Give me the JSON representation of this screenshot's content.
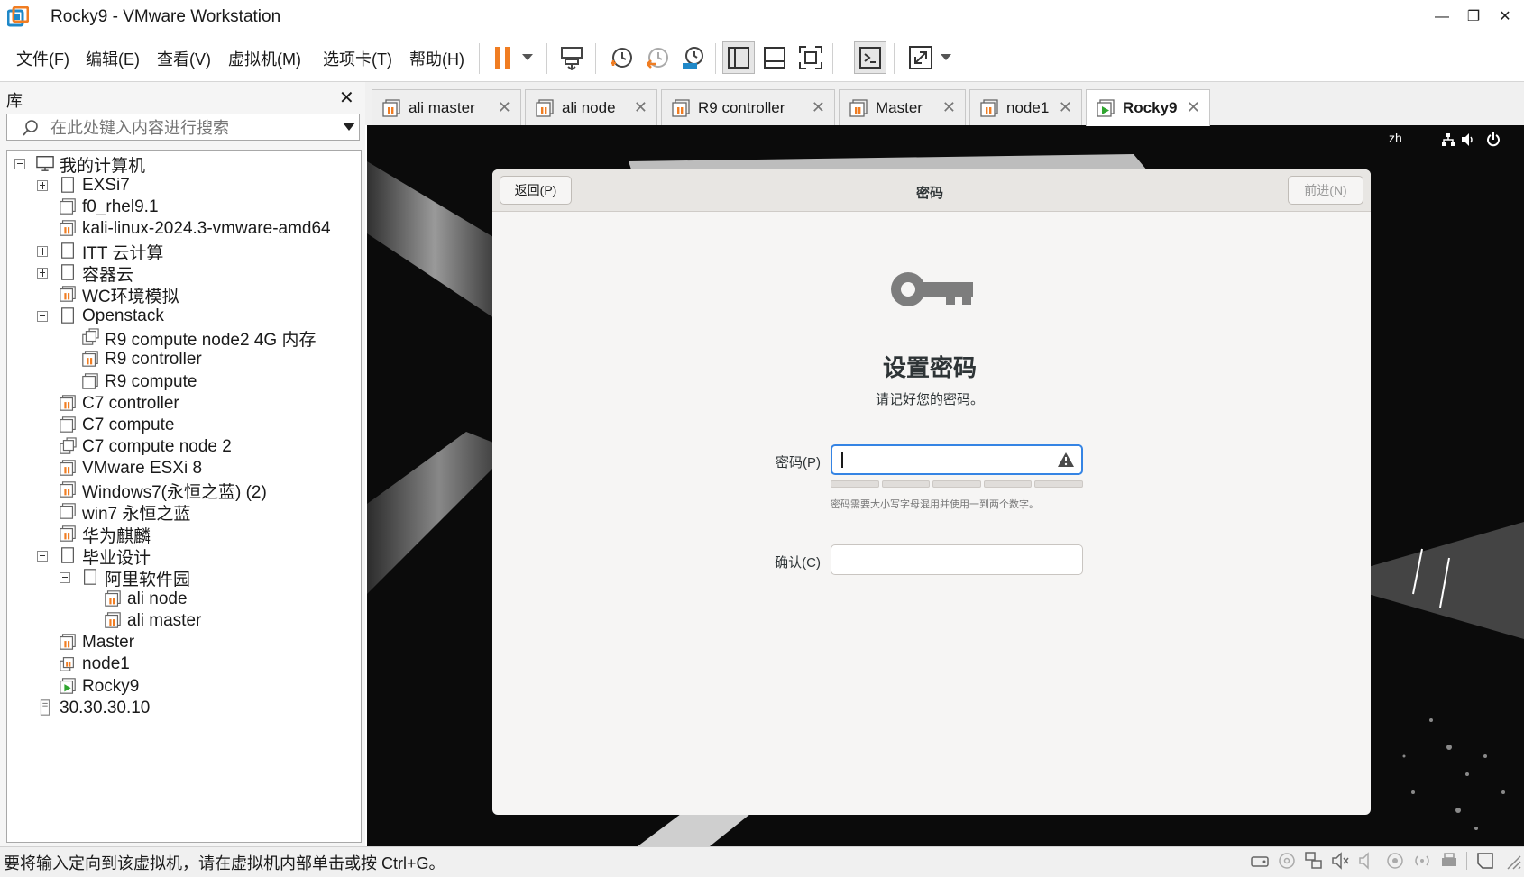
{
  "window": {
    "title": "Rocky9 - VMware Workstation",
    "controls": [
      "minimize-icon",
      "restore-icon",
      "close-icon"
    ]
  },
  "menu": {
    "items": [
      "文件(F)",
      "编辑(E)",
      "查看(V)",
      "虚拟机(M)",
      "选项卡(T)",
      "帮助(H)"
    ]
  },
  "toolbar": {
    "icons": [
      "pause-icon",
      "dropdown-arrow-icon",
      "send-ctrl-alt-del-icon",
      "snapshot-take-icon",
      "snapshot-revert-icon",
      "snapshot-manager-icon",
      "library-view-icon",
      "thumbnail-bar-icon",
      "fullscreen-icon",
      "console-view-icon",
      "stretch-guest-icon",
      "dropdown-arrow-icon"
    ],
    "accent_color": "#f07d22"
  },
  "library": {
    "title": "库",
    "search_placeholder": "在此处键入内容进行搜索",
    "tree": [
      {
        "label": "我的计算机",
        "level": 0,
        "expander": "minus",
        "icon": "computer-icon"
      },
      {
        "label": "EXSi7",
        "level": 1,
        "expander": "plus",
        "icon": "folder-icon"
      },
      {
        "label": "f0_rhel9.1",
        "level": 1,
        "expander": "",
        "icon": "vm-icon"
      },
      {
        "label": "kali-linux-2024.3-vmware-amd64",
        "level": 1,
        "expander": "",
        "icon": "vm-suspended-icon"
      },
      {
        "label": "ITT 云计算",
        "level": 1,
        "expander": "plus",
        "icon": "folder-icon"
      },
      {
        "label": "容器云",
        "level": 1,
        "expander": "plus",
        "icon": "folder-icon"
      },
      {
        "label": "WC环境模拟",
        "level": 1,
        "expander": "",
        "icon": "vm-suspended-icon"
      },
      {
        "label": "Openstack",
        "level": 1,
        "expander": "minus",
        "icon": "folder-icon"
      },
      {
        "label": "R9 compute node2 4G 内存",
        "level": 2,
        "expander": "",
        "icon": "vm-clone-icon"
      },
      {
        "label": "R9 controller",
        "level": 2,
        "expander": "",
        "icon": "vm-suspended-icon"
      },
      {
        "label": "R9 compute",
        "level": 2,
        "expander": "",
        "icon": "vm-icon"
      },
      {
        "label": "C7 controller",
        "level": 1,
        "expander": "",
        "icon": "vm-suspended-icon"
      },
      {
        "label": "C7 compute",
        "level": 1,
        "expander": "",
        "icon": "vm-icon"
      },
      {
        "label": "C7 compute node 2",
        "level": 1,
        "expander": "",
        "icon": "vm-clone-icon"
      },
      {
        "label": "VMware ESXi 8",
        "level": 1,
        "expander": "",
        "icon": "vm-suspended-icon"
      },
      {
        "label": "Windows7(永恒之蓝) (2)",
        "level": 1,
        "expander": "",
        "icon": "vm-suspended-icon"
      },
      {
        "label": "win7 永恒之蓝",
        "level": 1,
        "expander": "",
        "icon": "vm-icon"
      },
      {
        "label": "华为麒麟",
        "level": 1,
        "expander": "",
        "icon": "vm-suspended-icon"
      },
      {
        "label": "毕业设计",
        "level": 1,
        "expander": "minus",
        "icon": "folder-icon"
      },
      {
        "label": "阿里软件园",
        "level": 2,
        "expander": "minus",
        "icon": "folder-icon"
      },
      {
        "label": "ali node",
        "level": 3,
        "expander": "",
        "icon": "vm-suspended-icon"
      },
      {
        "label": "ali master",
        "level": 3,
        "expander": "",
        "icon": "vm-suspended-icon"
      },
      {
        "label": "Master",
        "level": 1,
        "expander": "",
        "icon": "vm-suspended-icon"
      },
      {
        "label": "node1",
        "level": 1,
        "expander": "",
        "icon": "vm-clone-suspended-icon"
      },
      {
        "label": "Rocky9",
        "level": 1,
        "expander": "",
        "icon": "vm-running-icon"
      },
      {
        "label": "30.30.30.10",
        "level": 0,
        "expander": "",
        "icon": "remote-server-icon"
      }
    ]
  },
  "tabs": [
    {
      "label": "ali master",
      "active": false
    },
    {
      "label": "ali node",
      "active": false
    },
    {
      "label": "R9 controller",
      "active": false
    },
    {
      "label": "Master",
      "active": false
    },
    {
      "label": "node1",
      "active": false
    },
    {
      "label": "Rocky9",
      "active": true
    }
  ],
  "guest": {
    "topbar_lang": "zh",
    "dialog": {
      "back_label": "返回(P)",
      "title": "密码",
      "next_label": "前进(N)",
      "heading": "设置密码",
      "subheading": "请记好您的密码。",
      "password_label": "密码(P)",
      "password_value": "",
      "password_hint": "密码需要大小写字母混用并使用一到两个数字。",
      "confirm_label": "确认(C)",
      "confirm_value": "",
      "focus_color": "#3584e4"
    }
  },
  "statusbar": {
    "message": "要将输入定向到该虚拟机，请在虚拟机内部单击或按 Ctrl+G。",
    "icons": [
      "hard-disk-icon",
      "cd-dvd-icon",
      "network-icon",
      "sound-icon",
      "speaker-icon",
      "camera-icon",
      "wireless-icon",
      "printer-icon",
      "separator",
      "message-icon",
      "resize-grip-icon"
    ]
  }
}
